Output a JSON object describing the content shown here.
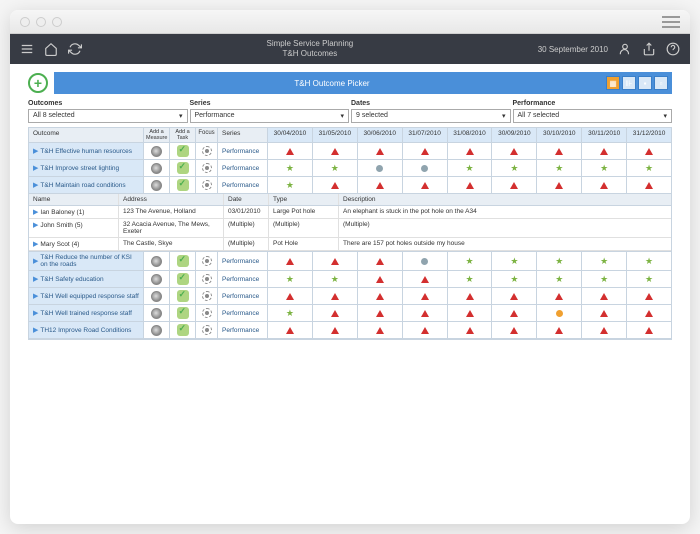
{
  "header": {
    "title1": "Simple Service Planning",
    "title2": "T&H Outcomes",
    "date": "30 September 2010"
  },
  "picker": {
    "title": "T&H Outcome Picker"
  },
  "filters": {
    "outcomes": {
      "label": "Outcomes",
      "value": "All 8 selected"
    },
    "series": {
      "label": "Series",
      "value": "Performance"
    },
    "dates": {
      "label": "Dates",
      "value": "9 selected"
    },
    "performance": {
      "label": "Performance",
      "value": "All 7 selected"
    }
  },
  "cols": {
    "outcome": "Outcome",
    "measure": "Add a Measure",
    "task": "Add a Task",
    "focus": "Focus",
    "series": "Series",
    "dates": [
      "30/04/2010",
      "31/05/2010",
      "30/06/2010",
      "31/07/2010",
      "31/08/2010",
      "30/09/2010",
      "30/10/2010",
      "30/11/2010",
      "31/12/2010"
    ]
  },
  "rows": [
    {
      "name": "T&H Effective human resources",
      "series": "Performance",
      "vals": [
        "red",
        "red",
        "red",
        "red",
        "red",
        "red",
        "red",
        "red",
        "red"
      ]
    },
    {
      "name": "T&H Improve street lighting",
      "series": "Performance",
      "vals": [
        "grn",
        "grn",
        "blu",
        "blu",
        "grn",
        "grn",
        "grn",
        "grn",
        "grn"
      ]
    },
    {
      "name": "T&H Maintain road conditions",
      "series": "Performance",
      "vals": [
        "grn",
        "red",
        "red",
        "red",
        "red",
        "red",
        "red",
        "red",
        "red"
      ]
    }
  ],
  "sub": {
    "hdr": {
      "name": "Name",
      "addr": "Address",
      "date": "Date",
      "type": "Type",
      "desc": "Description"
    },
    "rows": [
      {
        "name": "Ian Baloney (1)",
        "addr": "123 The Avenue, Holland",
        "date": "03/01/2010",
        "type": "Large Pot hole",
        "desc": "An elephant is stuck in the pot hole on the A34"
      },
      {
        "name": "John Smith (5)",
        "addr": "32 Acacia Avenue, The Mews, Exeter",
        "date": "(Multiple)",
        "type": "(Multiple)",
        "desc": "(Multiple)"
      },
      {
        "name": "Mary Scot (4)",
        "addr": "The Castle, Skye",
        "date": "(Multiple)",
        "type": "Pot Hole",
        "desc": "There are 157 pot holes outside my house"
      }
    ]
  },
  "rows2": [
    {
      "name": "T&H Reduce the number of KSI on the roads",
      "series": "Performance",
      "vals": [
        "red",
        "red",
        "red",
        "blu",
        "grn",
        "grn",
        "grn",
        "grn",
        "grn"
      ],
      "hl": true
    },
    {
      "name": "T&H Safety education",
      "series": "Performance",
      "vals": [
        "grn",
        "grn",
        "red",
        "red",
        "grn",
        "grn",
        "grn",
        "grn",
        "grn"
      ]
    },
    {
      "name": "T&H Well equipped response staff",
      "series": "Performance",
      "vals": [
        "red",
        "red",
        "red",
        "red",
        "red",
        "red",
        "red",
        "red",
        "red"
      ]
    },
    {
      "name": "T&H Well trained response staff",
      "series": "Performance",
      "vals": [
        "grn",
        "red",
        "red",
        "red",
        "red",
        "red",
        "amber",
        "red",
        "red"
      ]
    },
    {
      "name": "TH12 Improve Road Conditions",
      "series": "Performance",
      "vals": [
        "red",
        "red",
        "red",
        "red",
        "red",
        "red",
        "red",
        "red",
        "red"
      ]
    }
  ]
}
